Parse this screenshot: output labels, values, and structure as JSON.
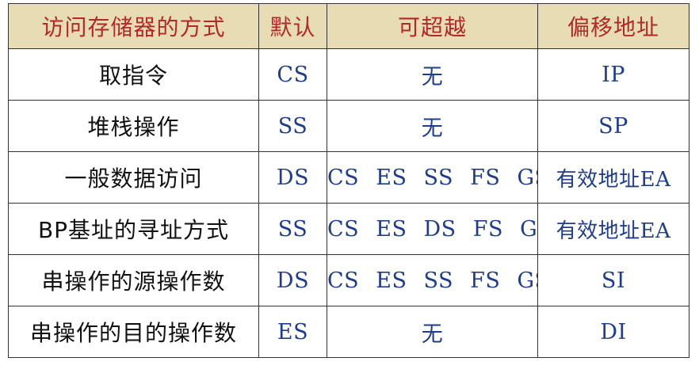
{
  "table": {
    "headers": [
      "访问存储器的方式",
      "默认",
      "可超越",
      "偏移地址"
    ],
    "rows": [
      {
        "access": "取指令",
        "default": "CS",
        "override": "无",
        "offset": "IP"
      },
      {
        "access": "堆栈操作",
        "default": "SS",
        "override": "无",
        "offset": "SP"
      },
      {
        "access": "一般数据访问",
        "default": "DS",
        "override": "CS ES SS FS GS",
        "offset": "有效地址EA"
      },
      {
        "access": "BP基址的寻址方式",
        "default": "SS",
        "override": "CS ES DS FS GS",
        "offset": "有效地址EA"
      },
      {
        "access": "串操作的源操作数",
        "default": "DS",
        "override": "CS ES SS FS GS",
        "offset": "SI"
      },
      {
        "access": "串操作的目的操作数",
        "default": "ES",
        "override": "无",
        "offset": "DI"
      }
    ]
  },
  "colors": {
    "header_bg": "#e8dcb4",
    "header_text": "#b02a2a",
    "register_text": "#1f3d8a",
    "operation_text": "#111111",
    "border": "#333333"
  }
}
